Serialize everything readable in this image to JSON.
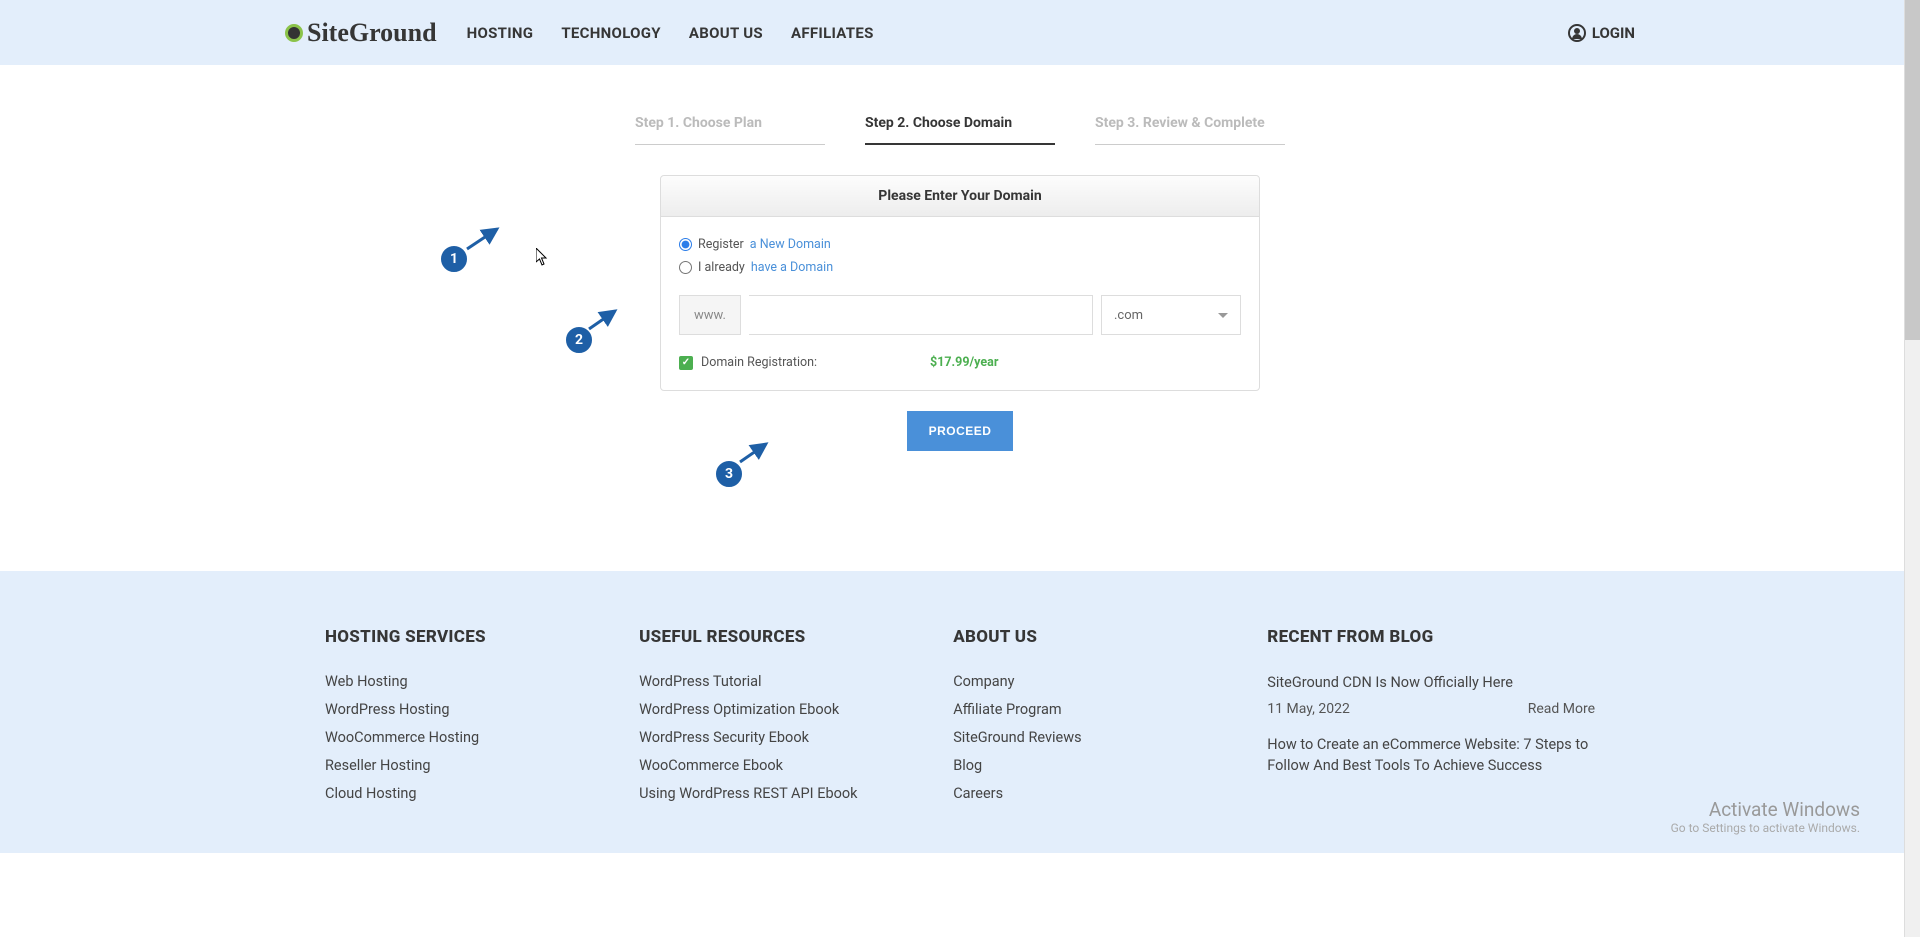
{
  "header": {
    "logo_text": "SiteGround",
    "nav": [
      "HOSTING",
      "TECHNOLOGY",
      "ABOUT US",
      "AFFILIATES"
    ],
    "login": "LOGIN"
  },
  "steps": {
    "step1": "Step 1. Choose Plan",
    "step2": "Step 2. Choose Domain",
    "step3": "Step 3. Review & Complete"
  },
  "panel": {
    "title": "Please Enter Your Domain",
    "register_plain": "Register ",
    "register_link": "a New Domain",
    "have_plain": "I already ",
    "have_link": "have a Domain",
    "www": "www.",
    "tld": ".com",
    "checkbox_label": "Domain Registration:",
    "price": "$17.99/year"
  },
  "proceed": "PROCEED",
  "annotations": {
    "a1": "1",
    "a2": "2",
    "a3": "3"
  },
  "footer": {
    "col1": {
      "title": "HOSTING SERVICES",
      "items": [
        "Web Hosting",
        "WordPress Hosting",
        "WooCommerce Hosting",
        "Reseller Hosting",
        "Cloud Hosting"
      ]
    },
    "col2": {
      "title": "USEFUL RESOURCES",
      "items": [
        "WordPress Tutorial",
        "WordPress Optimization Ebook",
        "WordPress Security Ebook",
        "WooCommerce Ebook",
        "Using WordPress REST API Ebook"
      ]
    },
    "col3": {
      "title": "ABOUT US",
      "items": [
        "Company",
        "Affiliate Program",
        "SiteGround Reviews",
        "Blog",
        "Careers"
      ]
    },
    "col4": {
      "title": "RECENT FROM BLOG",
      "blog1_title": "SiteGround CDN Is Now Officially Here",
      "blog1_date": "11 May, 2022",
      "blog1_read": "Read More",
      "blog2_title": "How to Create an eCommerce Website: 7 Steps to Follow And Best Tools To Achieve Success"
    }
  },
  "watermark": {
    "line1": "Activate Windows",
    "line2": "Go to Settings to activate Windows."
  }
}
